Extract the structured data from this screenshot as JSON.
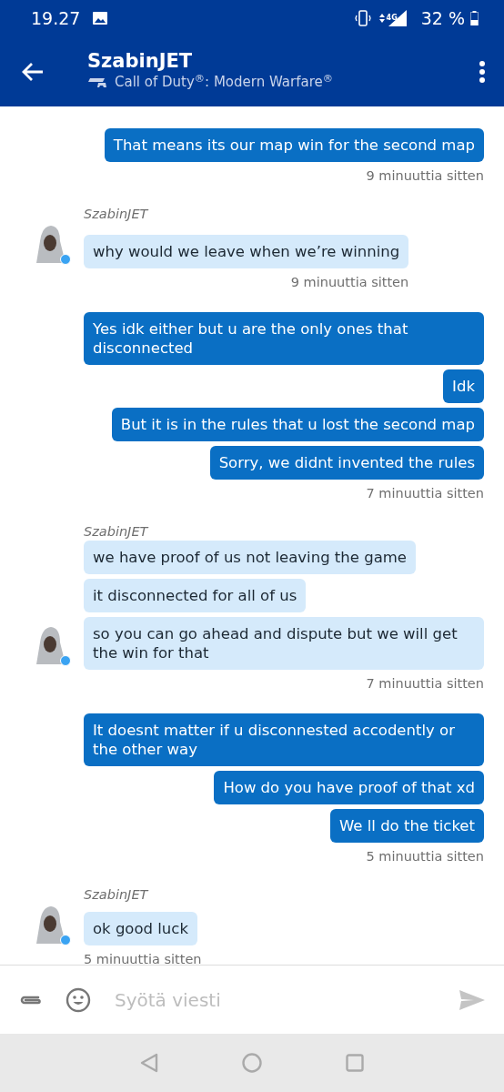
{
  "status_bar": {
    "time": "19.27",
    "battery": "32 %",
    "network": "4G"
  },
  "header": {
    "title": "SzabinJET",
    "subtitle": "Call of Duty$^{®}$: Modern Warfare$^{®}$"
  },
  "groups": [
    {
      "kind": "outgoing",
      "messages": [
        "That means its our map win for the second map"
      ],
      "time": "9 minuuttia sitten"
    },
    {
      "kind": "incoming",
      "sender": "SzabinJET",
      "online": true,
      "messages": [
        "why would we leave when we’re winning"
      ],
      "time": "9 minuuttia sitten"
    },
    {
      "kind": "outgoing",
      "messages": [
        "Yes idk either but u are the only ones that disconnected",
        "Idk",
        "But it is in the rules that u lost the second map",
        "Sorry, we didnt invented the rules"
      ],
      "time": "7 minuuttia sitten"
    },
    {
      "kind": "incoming",
      "sender": "SzabinJET",
      "online": true,
      "messages": [
        "we have proof of us not leaving the game",
        "it disconnected for all of us",
        "so you can go ahead and dispute but we will get the win for that"
      ],
      "time": "7 minuuttia sitten"
    },
    {
      "kind": "outgoing",
      "messages": [
        "It doesnt matter if u disconnested accodently or the other way",
        "How do you have proof of that xd",
        "We ll do the ticket"
      ],
      "time": "5 minuuttia sitten"
    },
    {
      "kind": "incoming",
      "sender": "SzabinJET",
      "online": true,
      "messages": [
        "ok good luck"
      ],
      "time": "5 minuuttia sitten"
    }
  ],
  "composer": {
    "placeholder": "Syötä viesti"
  }
}
